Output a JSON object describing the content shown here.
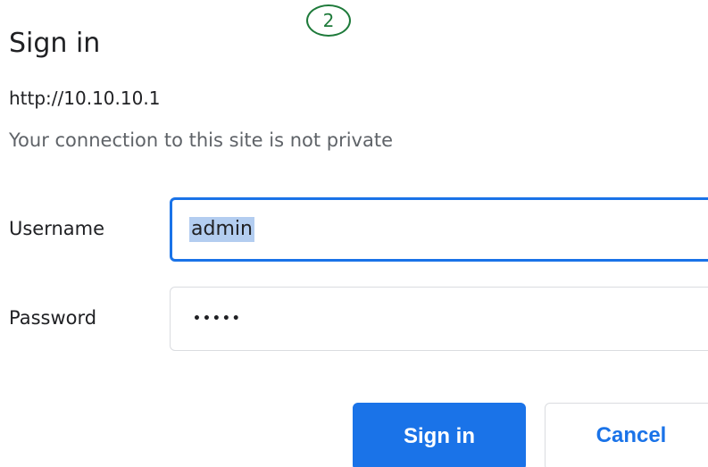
{
  "step_marker": "2",
  "dialog": {
    "title": "Sign in",
    "site_url": "http://10.10.10.1",
    "privacy_note": "Your connection to this site is not private"
  },
  "form": {
    "username": {
      "label": "Username",
      "value": "admin",
      "focused": true,
      "text_selected": true
    },
    "password": {
      "label": "Password",
      "masked_value": "•••••"
    }
  },
  "buttons": {
    "sign_in": "Sign in",
    "cancel": "Cancel"
  },
  "colors": {
    "accent": "#1a73e8",
    "selection": "#b3cdf0",
    "marker": "#1e7a3a",
    "muted_text": "#5f6368"
  }
}
